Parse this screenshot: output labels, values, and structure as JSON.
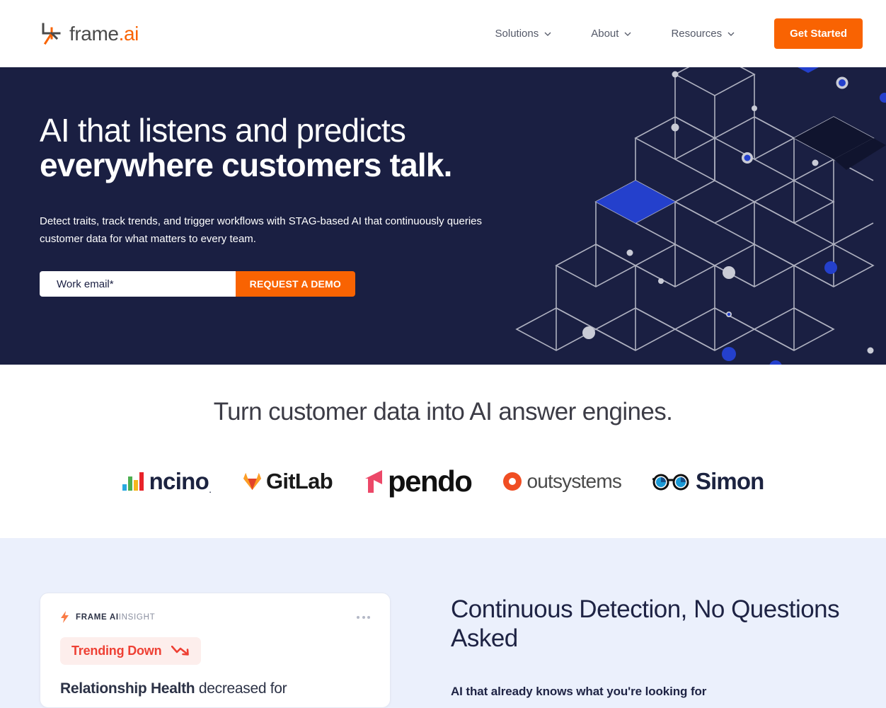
{
  "brand": {
    "name": "frame",
    "suffix": ".ai",
    "accent_orange": "#f96302",
    "navy": "#1a1f42",
    "light_blue_bg": "#ebf0fc",
    "red": "#ee4034"
  },
  "header": {
    "nav_items": [
      {
        "label": "Solutions",
        "icon": "chevron-down-icon"
      },
      {
        "label": "About",
        "icon": "chevron-down-icon"
      },
      {
        "label": "Resources",
        "icon": "chevron-down-icon"
      }
    ],
    "cta_label": "Get Started"
  },
  "hero": {
    "headline_line1": "AI that listens and predicts",
    "headline_line2": "everywhere customers talk.",
    "subtext": "Detect traits, track trends, and trigger workflows with STAG-based AI that continuously queries customer data for what matters to every team.",
    "email_placeholder": "Work email*",
    "email_value": "",
    "submit_label": "REQUEST A DEMO"
  },
  "logos_section": {
    "title": "Turn customer data into AI answer engines.",
    "logos": [
      {
        "name": "ncino",
        "label": "ncino",
        "icon": "ncino-bars-icon"
      },
      {
        "name": "gitlab",
        "label": "GitLab",
        "icon": "gitlab-fox-icon"
      },
      {
        "name": "pendo",
        "label": "pendo",
        "icon": "pendo-arrow-icon"
      },
      {
        "name": "outsystems",
        "label": "outsystems",
        "icon": "outsystems-donut-icon"
      },
      {
        "name": "simon",
        "label": "Simon",
        "icon": "simon-glasses-icon"
      }
    ]
  },
  "detection_section": {
    "card": {
      "icon": "lightning-bolt-icon",
      "label_bold": "FRAME AI",
      "label_light": "INSIGHT",
      "menu_icon": "more-options-icon",
      "badge_text": "Trending Down",
      "badge_icon": "trending-down-arrow-icon",
      "body_bold": "Relationship Health",
      "body_rest": " decreased for"
    },
    "heading": "Continuous Detection, No Questions Asked",
    "subheading": "AI that already knows what you're looking for"
  }
}
